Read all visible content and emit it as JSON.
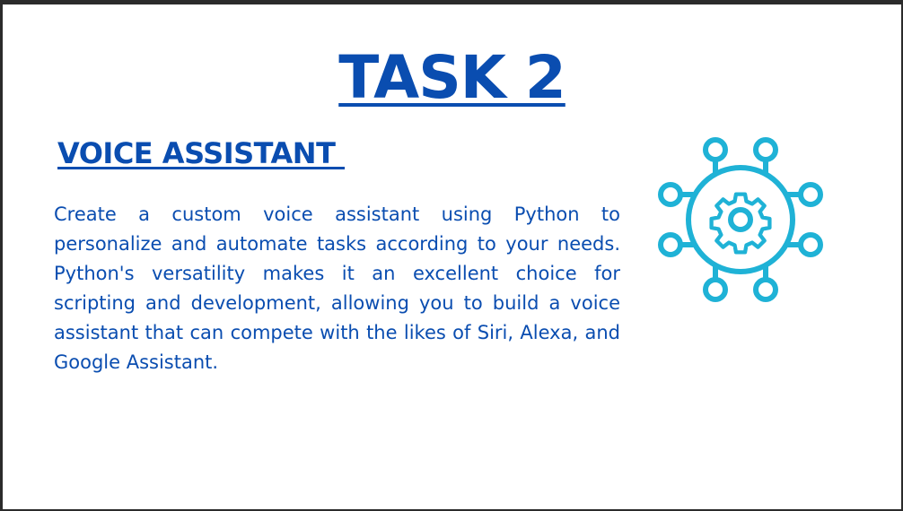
{
  "slide": {
    "title": "TASK 2",
    "subtitle": "VOICE ASSISTANT ",
    "description": "Create a custom voice assistant using Python to personalize and automate tasks according to your needs. Python's versatility makes it an excellent choice for scripting and development, allowing you to build a voice assistant that can compete with the likes of Siri, Alexa, and Google Assistant.",
    "icon": "network-gear-icon"
  },
  "colors": {
    "text": "#0a4db0",
    "icon": "#1fb2d6",
    "background": "#ffffff",
    "frame": "#2b2b2b"
  }
}
